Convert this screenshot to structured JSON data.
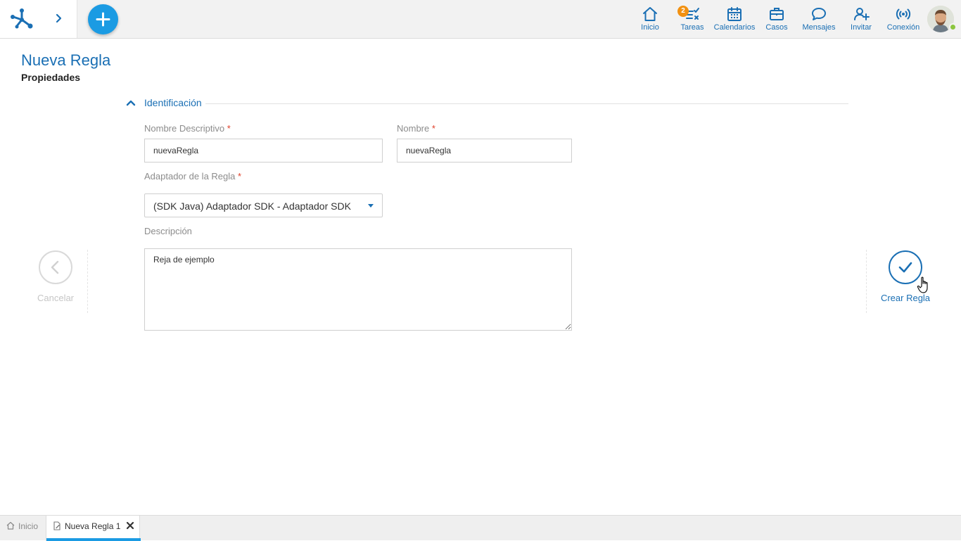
{
  "topbar": {
    "nav": [
      {
        "id": "inicio",
        "label": "Inicio",
        "icon": "home-icon"
      },
      {
        "id": "tareas",
        "label": "Tareas",
        "icon": "tasks-icon",
        "badge": "2"
      },
      {
        "id": "calendarios",
        "label": "Calendarios",
        "icon": "calendar-icon"
      },
      {
        "id": "casos",
        "label": "Casos",
        "icon": "briefcase-icon"
      },
      {
        "id": "mensajes",
        "label": "Mensajes",
        "icon": "chat-icon"
      },
      {
        "id": "invitar",
        "label": "Invitar",
        "icon": "invite-user-icon"
      },
      {
        "id": "conexion",
        "label": "Conexión",
        "icon": "broadcast-icon"
      }
    ]
  },
  "page": {
    "title": "Nueva Regla",
    "subtitle": "Propiedades"
  },
  "section": {
    "title": "Identificación"
  },
  "form": {
    "nombre_descriptivo": {
      "label": "Nombre Descriptivo",
      "required_mark": "*",
      "value": "nuevaRegla"
    },
    "nombre": {
      "label": "Nombre",
      "required_mark": "*",
      "value": "nuevaRegla"
    },
    "adaptador": {
      "label": "Adaptador de la Regla",
      "required_mark": "*",
      "value": "(SDK Java) Adaptador SDK - Adaptador SDK"
    },
    "descripcion": {
      "label": "Descripción",
      "value": "Reja de ejemplo"
    }
  },
  "actions": {
    "cancel_label": "Cancelar",
    "create_label": "Crear Regla"
  },
  "tabs": [
    {
      "label": "Inicio",
      "active": false
    },
    {
      "label": "Nueva Regla 1",
      "active": true
    }
  ],
  "colors": {
    "accent": "#1a6fb4",
    "add_button": "#1b9be3",
    "badge": "#f29111",
    "required": "#e0412b",
    "online": "#8cc63f"
  }
}
